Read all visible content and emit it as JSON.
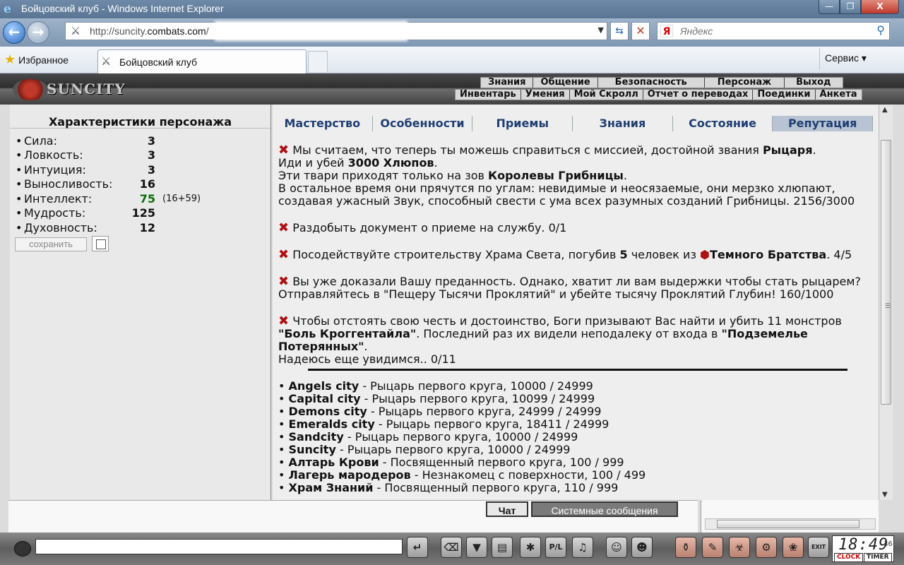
{
  "window": {
    "title": "Бойцовский клуб - Windows Internet Explorer",
    "min": "—",
    "max": "❐",
    "close": "X"
  },
  "address": {
    "url_prefix": "http://suncity.",
    "url_domain": "combats.com",
    "url_rest": "/",
    "search_placeholder": "Яндекс",
    "search_logo": "Я"
  },
  "favbar": {
    "favorites_label": "Избранное",
    "tab_label": "Бойцовский клуб",
    "service_label": "Сервис ▾"
  },
  "game": {
    "brand": "SUNCITY",
    "menu_top": [
      "Знания",
      "Общение",
      "Безопасность",
      "Персонаж",
      "Выход"
    ],
    "menu_sub": [
      "Инвентарь",
      "Умения",
      "Мой Скролл",
      "Отчет о переводах",
      "Поединки",
      "Анкета"
    ],
    "char_title": "Характеристики персонажа",
    "stats": [
      {
        "name": "Сила:",
        "value": "3"
      },
      {
        "name": "Ловкость:",
        "value": "3"
      },
      {
        "name": "Интуиция:",
        "value": "3"
      },
      {
        "name": "Выносливость:",
        "value": "16"
      },
      {
        "name": "Интеллект:",
        "value": "75",
        "extra": "(16+59)"
      },
      {
        "name": "Мудрость:",
        "value": "125"
      },
      {
        "name": "Духовность:",
        "value": "12"
      }
    ],
    "save_label": "сохранить",
    "tabs": [
      "Мастерство",
      "Особенности",
      "Приемы",
      "Знания",
      "Состояние",
      "Репутация"
    ],
    "active_tab": "Репутация",
    "quests": {
      "q1_a": "Мы считаем, что теперь ты можешь справиться с миссией, достойной звания ",
      "q1_b": "Рыцаря",
      "q1_c": "Иди и убей ",
      "q1_d": "3000 Хлюпов",
      "q1_e": "Эти твари приходят только на зов ",
      "q1_f": "Королевы Грибницы",
      "q1_g": "В остальное время они прячутся по углам: невидимые и неосязаемые, они мерзко хлюпают,",
      "q1_h": "создавая ужасный Звук, способный свести с ума всех разумных созданий Грибницы. 2156/3000",
      "q2": "Раздобыть документ о приеме на службу. 0/1",
      "q3_a": "Посодействуйте строительству Храма Света, погубив ",
      "q3_b": "5",
      "q3_c": " человек из ",
      "q3_d": "Темного Братства",
      "q3_e": ". 4/5",
      "q4_a": "Вы уже доказали Вашу преданность. Однако, хватит ли вам выдержки чтобы стать рыцарем?",
      "q4_b": "Отправляйтесь в \"Пещеру Тысячи Проклятий\" и убейте тысячу Проклятий Глубин! 160/1000",
      "q5_a": "Чтобы отстоять свою честь и достоинство, Боги призывают Вас найти и убить 11 монстров ",
      "q5_b": "\"Боль Кроггентайла\"",
      "q5_c": ". Последний раз их видели неподалеку от входа в ",
      "q5_d": "\"Подземелье Потерянных\"",
      "q5_e": "Надеюсь еще увидимся.. 0/11"
    },
    "reputation": [
      {
        "city": "Angels city",
        "text": " - Рыцарь первого круга, 10000 / 24999"
      },
      {
        "city": "Capital city",
        "text": " - Рыцарь первого круга, 10099 / 24999"
      },
      {
        "city": "Demons city",
        "text": " - Рыцарь первого круга, 24999 / 24999"
      },
      {
        "city": "Emeralds city",
        "text": " - Рыцарь первого круга, 18411 / 24999"
      },
      {
        "city": "Sandcity",
        "text": " - Рыцарь первого круга, 10000 / 24999"
      },
      {
        "city": "Suncity",
        "text": " - Рыцарь первого круга, 10000 / 24999"
      },
      {
        "city": "Алтарь Крови",
        "text": " - Посвященный первого круга, 100 / 999"
      },
      {
        "city": "Лагерь мародеров",
        "text": " - Незнакомец с поверхности, 100 / 499"
      },
      {
        "city": "Храм Знаний",
        "text": " - Посвященный первого круга, 110 / 999"
      }
    ],
    "chat_tab": "Чат",
    "sys_tab": "Системные сообщения",
    "clock": {
      "time": "18:49",
      "seconds": "36",
      "clock_label": "CLOCK",
      "timer_label": "TIMER"
    },
    "toolbar_glyphs": [
      "↵",
      "⌫",
      "▼",
      "▤",
      "✱",
      "P/L",
      "♫",
      "☺",
      "☻",
      "⚱",
      "✎",
      "☣",
      "⚙",
      "❀",
      "EXIT"
    ]
  }
}
